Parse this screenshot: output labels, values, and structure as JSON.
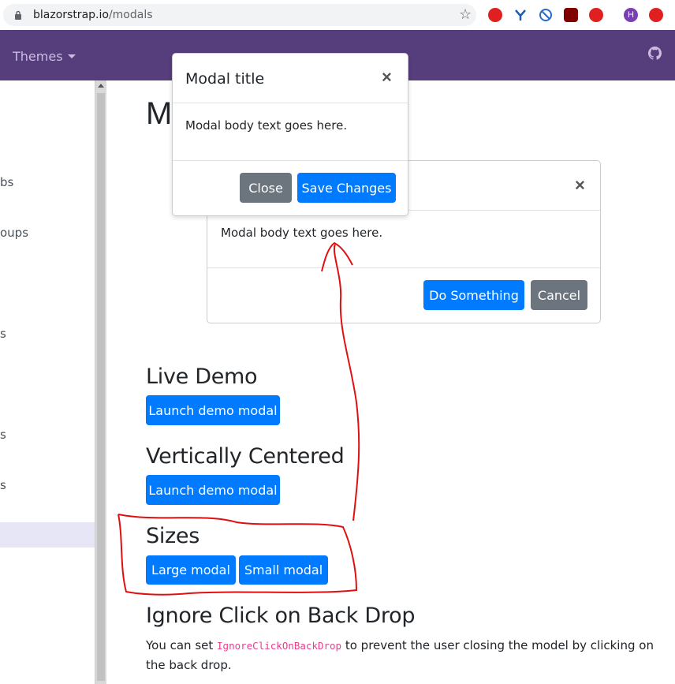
{
  "browser": {
    "url_host": "blazorstrap.io",
    "url_path": "/modals",
    "avatar_letter": "H"
  },
  "navbar": {
    "themes_label": "Themes"
  },
  "sidebar": {
    "items": [
      "bs",
      "oups",
      "s",
      "s",
      "s"
    ]
  },
  "page": {
    "title_fragment": "M",
    "sections": {
      "live_demo": "Live Demo",
      "vertically_centered": "Vertically Centered",
      "sizes": "Sizes",
      "ignore_click": "Ignore Click on Back Drop"
    },
    "buttons": {
      "launch_demo_1": "Launch demo modal",
      "launch_demo_2": "Launch demo modal",
      "large_modal": "Large modal",
      "small_modal": "Small modal"
    },
    "paragraph": {
      "before": "You can set ",
      "code": "IgnoreClickOnBackDrop",
      "after": " to prevent the user closing the model by clicking on the back drop."
    }
  },
  "modal_back": {
    "body": "Modal body text goes here.",
    "primary_label": "Do Something",
    "secondary_label": "Cancel",
    "close_glyph": "×"
  },
  "modal_front": {
    "title": "Modal title",
    "body": "Modal body text goes here.",
    "close_label": "Close",
    "save_label": "Save Changes",
    "close_glyph": "×"
  }
}
